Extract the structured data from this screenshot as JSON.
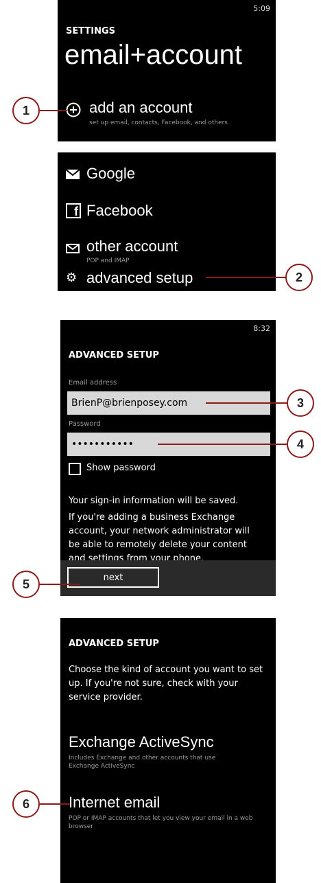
{
  "panel1": {
    "time": "5:09",
    "settings_label": "SETTINGS",
    "title": "email+account",
    "add_account_label": "add an account",
    "add_account_sub": "set up email, contacts, Facebook, and others"
  },
  "panel2": {
    "google_label": "Google",
    "facebook_label": "Facebook",
    "other_label": "other account",
    "other_sub": "POP and IMAP",
    "advanced_label": "advanced setup"
  },
  "panel3": {
    "time": "8:32",
    "heading": "ADVANCED SETUP",
    "email_label": "Email address",
    "email_value": "BrienP@brienposey.com",
    "password_label": "Password",
    "password_value": "•••••••••••",
    "show_password_label": "Show password",
    "info_line1": "Your sign-in information will be saved.",
    "info_line2": "If you're adding a business Exchange account, your network administrator will be able to remotely delete your content and settings from your phone.",
    "next_label": "next"
  },
  "panel4": {
    "heading": "ADVANCED SETUP",
    "intro": "Choose the kind of account you want to set up. If you're not sure, check with your service provider.",
    "exchange_label": "Exchange ActiveSync",
    "exchange_sub": "Includes Exchange and other accounts that use Exchange ActiveSync",
    "internet_label": "Internet email",
    "internet_sub": "POP or IMAP accounts that let you view your email in a web browser"
  },
  "callouts": [
    "1",
    "2",
    "3",
    "4",
    "5",
    "6"
  ]
}
